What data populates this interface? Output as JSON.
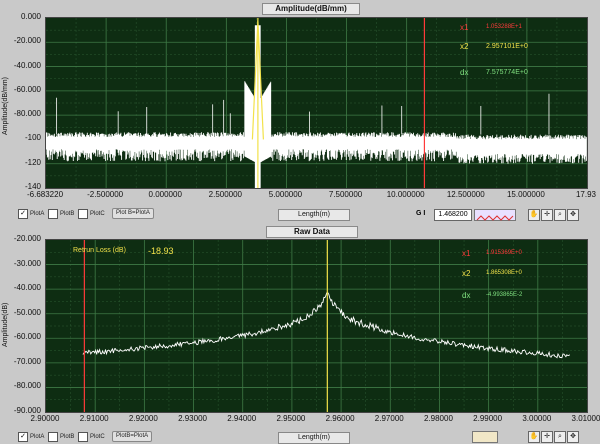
{
  "top": {
    "title": "Amplitude(dB/mm)",
    "ylabel": "Amplitude(dB/mm)",
    "xlabel": "Length(m)",
    "yticks": [
      "0.000",
      "-20.000",
      "-40.000",
      "-60.000",
      "-80.000",
      "-100",
      "-120",
      "-140"
    ],
    "xticks": [
      "-6.683220",
      "-2.500000",
      "0.000000",
      "2.500000",
      "5.000000",
      "7.500000",
      "10.000000",
      "12.500000",
      "15.000000",
      "17.93"
    ],
    "cursors": [
      {
        "name": "x1",
        "value": "1.053288E+1",
        "color": "#ff3a3a"
      },
      {
        "name": "x2",
        "value": "2.957101E+0",
        "color": "#f2e24a"
      },
      {
        "name": "dx",
        "value": "7.575774E+0",
        "color": "#7fe07f"
      }
    ],
    "plots": [
      "PlotA",
      "PlotB",
      "PlotC"
    ],
    "plot_checked": [
      true,
      false,
      false
    ],
    "swap_button": "Plot B=PlotA",
    "g_label": "G I",
    "numeric_value": "1.468200"
  },
  "bottom": {
    "title": "Raw Data",
    "ylabel": "Amplitude(dB)",
    "xlabel": "Length(m)",
    "yticks": [
      "-20.000",
      "-30.000",
      "-40.000",
      "-50.000",
      "-60.000",
      "-70.000",
      "-80.000",
      "-90.000"
    ],
    "xticks": [
      "2.90000",
      "2.91000",
      "2.92000",
      "2.93000",
      "2.94000",
      "2.95000",
      "2.96000",
      "2.97000",
      "2.98000",
      "2.99000",
      "3.00000",
      "3.01000"
    ],
    "return_loss_label": "Retrun Loss  (dB)",
    "return_loss_value": "-18.93",
    "cursors": [
      {
        "name": "x1",
        "value": "1.915369E+0",
        "color": "#ff3a3a"
      },
      {
        "name": "x2",
        "value": "1.865308E+0",
        "color": "#f2e24a"
      },
      {
        "name": "dx",
        "value": "-4.993865E-2",
        "color": "#7fe07f"
      }
    ],
    "plots": [
      "PlotA",
      "PlotB",
      "PlotC"
    ],
    "plot_checked": [
      true,
      false,
      false
    ],
    "swap_button": "PlotB=PlotA"
  }
}
